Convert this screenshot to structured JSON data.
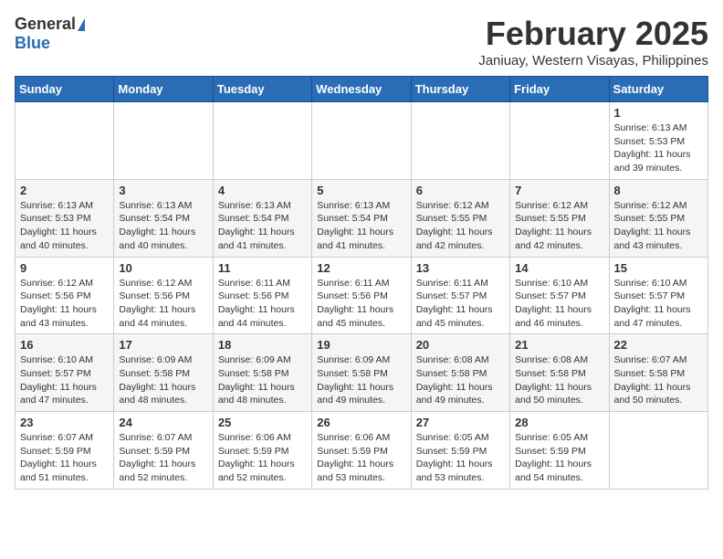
{
  "header": {
    "logo": {
      "general": "General",
      "blue": "Blue",
      "tagline": ""
    },
    "title": "February 2025",
    "location": "Janiuay, Western Visayas, Philippines"
  },
  "weekdays": [
    "Sunday",
    "Monday",
    "Tuesday",
    "Wednesday",
    "Thursday",
    "Friday",
    "Saturday"
  ],
  "weeks": [
    [
      {
        "day": "",
        "info": ""
      },
      {
        "day": "",
        "info": ""
      },
      {
        "day": "",
        "info": ""
      },
      {
        "day": "",
        "info": ""
      },
      {
        "day": "",
        "info": ""
      },
      {
        "day": "",
        "info": ""
      },
      {
        "day": "1",
        "info": "Sunrise: 6:13 AM\nSunset: 5:53 PM\nDaylight: 11 hours\nand 39 minutes."
      }
    ],
    [
      {
        "day": "2",
        "info": "Sunrise: 6:13 AM\nSunset: 5:53 PM\nDaylight: 11 hours\nand 40 minutes."
      },
      {
        "day": "3",
        "info": "Sunrise: 6:13 AM\nSunset: 5:54 PM\nDaylight: 11 hours\nand 40 minutes."
      },
      {
        "day": "4",
        "info": "Sunrise: 6:13 AM\nSunset: 5:54 PM\nDaylight: 11 hours\nand 41 minutes."
      },
      {
        "day": "5",
        "info": "Sunrise: 6:13 AM\nSunset: 5:54 PM\nDaylight: 11 hours\nand 41 minutes."
      },
      {
        "day": "6",
        "info": "Sunrise: 6:12 AM\nSunset: 5:55 PM\nDaylight: 11 hours\nand 42 minutes."
      },
      {
        "day": "7",
        "info": "Sunrise: 6:12 AM\nSunset: 5:55 PM\nDaylight: 11 hours\nand 42 minutes."
      },
      {
        "day": "8",
        "info": "Sunrise: 6:12 AM\nSunset: 5:55 PM\nDaylight: 11 hours\nand 43 minutes."
      }
    ],
    [
      {
        "day": "9",
        "info": "Sunrise: 6:12 AM\nSunset: 5:56 PM\nDaylight: 11 hours\nand 43 minutes."
      },
      {
        "day": "10",
        "info": "Sunrise: 6:12 AM\nSunset: 5:56 PM\nDaylight: 11 hours\nand 44 minutes."
      },
      {
        "day": "11",
        "info": "Sunrise: 6:11 AM\nSunset: 5:56 PM\nDaylight: 11 hours\nand 44 minutes."
      },
      {
        "day": "12",
        "info": "Sunrise: 6:11 AM\nSunset: 5:56 PM\nDaylight: 11 hours\nand 45 minutes."
      },
      {
        "day": "13",
        "info": "Sunrise: 6:11 AM\nSunset: 5:57 PM\nDaylight: 11 hours\nand 45 minutes."
      },
      {
        "day": "14",
        "info": "Sunrise: 6:10 AM\nSunset: 5:57 PM\nDaylight: 11 hours\nand 46 minutes."
      },
      {
        "day": "15",
        "info": "Sunrise: 6:10 AM\nSunset: 5:57 PM\nDaylight: 11 hours\nand 47 minutes."
      }
    ],
    [
      {
        "day": "16",
        "info": "Sunrise: 6:10 AM\nSunset: 5:57 PM\nDaylight: 11 hours\nand 47 minutes."
      },
      {
        "day": "17",
        "info": "Sunrise: 6:09 AM\nSunset: 5:58 PM\nDaylight: 11 hours\nand 48 minutes."
      },
      {
        "day": "18",
        "info": "Sunrise: 6:09 AM\nSunset: 5:58 PM\nDaylight: 11 hours\nand 48 minutes."
      },
      {
        "day": "19",
        "info": "Sunrise: 6:09 AM\nSunset: 5:58 PM\nDaylight: 11 hours\nand 49 minutes."
      },
      {
        "day": "20",
        "info": "Sunrise: 6:08 AM\nSunset: 5:58 PM\nDaylight: 11 hours\nand 49 minutes."
      },
      {
        "day": "21",
        "info": "Sunrise: 6:08 AM\nSunset: 5:58 PM\nDaylight: 11 hours\nand 50 minutes."
      },
      {
        "day": "22",
        "info": "Sunrise: 6:07 AM\nSunset: 5:58 PM\nDaylight: 11 hours\nand 50 minutes."
      }
    ],
    [
      {
        "day": "23",
        "info": "Sunrise: 6:07 AM\nSunset: 5:59 PM\nDaylight: 11 hours\nand 51 minutes."
      },
      {
        "day": "24",
        "info": "Sunrise: 6:07 AM\nSunset: 5:59 PM\nDaylight: 11 hours\nand 52 minutes."
      },
      {
        "day": "25",
        "info": "Sunrise: 6:06 AM\nSunset: 5:59 PM\nDaylight: 11 hours\nand 52 minutes."
      },
      {
        "day": "26",
        "info": "Sunrise: 6:06 AM\nSunset: 5:59 PM\nDaylight: 11 hours\nand 53 minutes."
      },
      {
        "day": "27",
        "info": "Sunrise: 6:05 AM\nSunset: 5:59 PM\nDaylight: 11 hours\nand 53 minutes."
      },
      {
        "day": "28",
        "info": "Sunrise: 6:05 AM\nSunset: 5:59 PM\nDaylight: 11 hours\nand 54 minutes."
      },
      {
        "day": "",
        "info": ""
      }
    ]
  ]
}
